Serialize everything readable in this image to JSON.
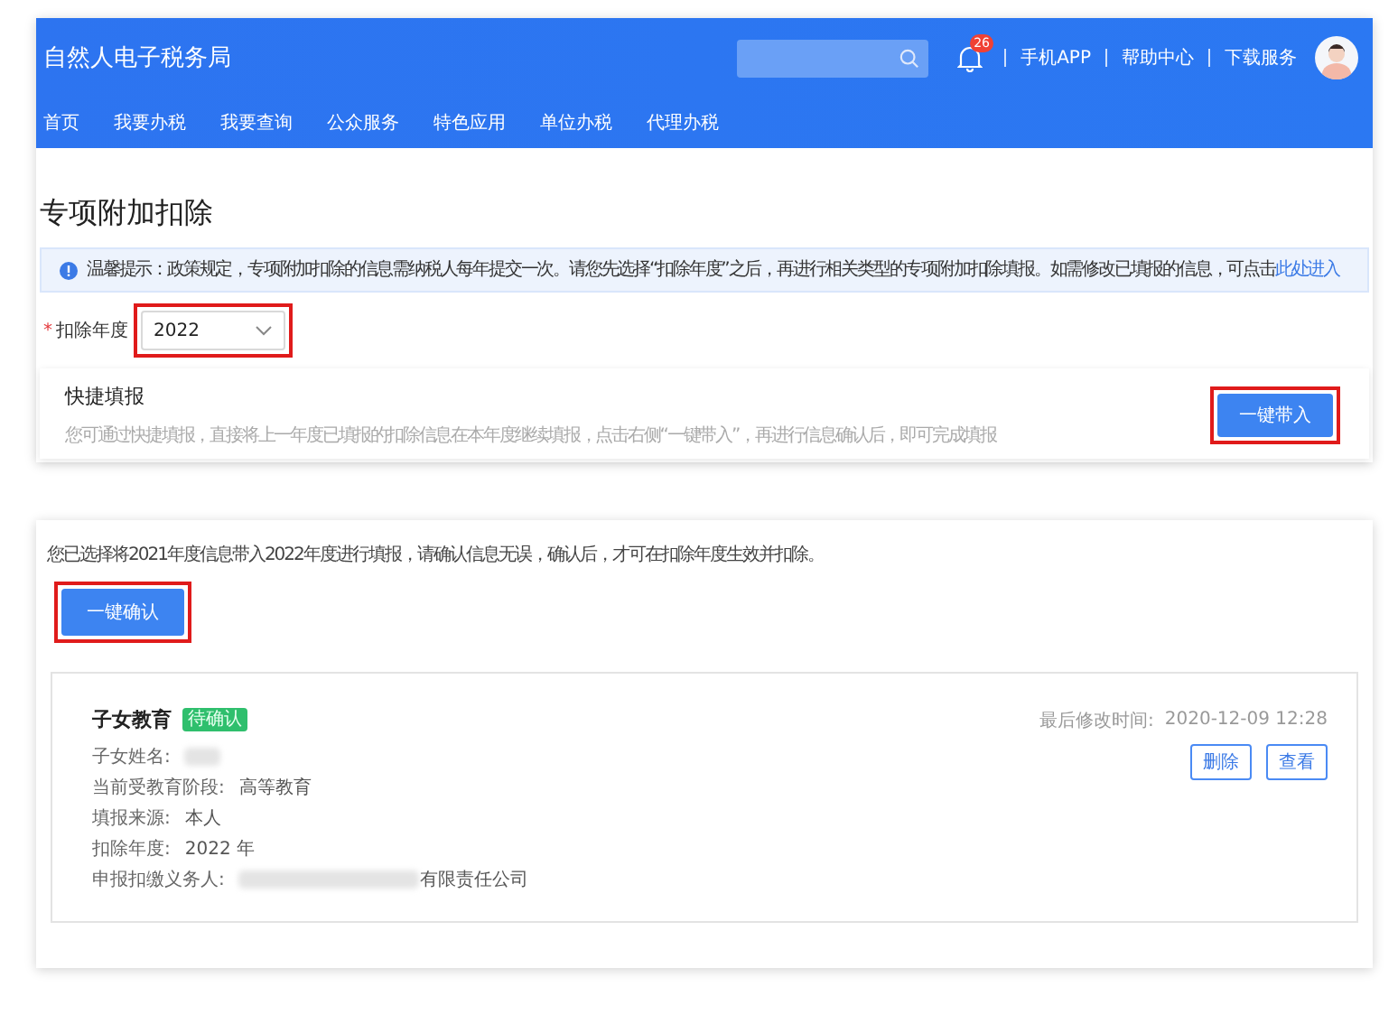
{
  "header": {
    "site_title": "自然人电子税务局",
    "notification_count": "26",
    "links": [
      "手机APP",
      "帮助中心",
      "下载服务"
    ]
  },
  "nav": [
    {
      "label": "首页",
      "selected": false
    },
    {
      "label": "我要办税",
      "selected": false
    },
    {
      "label": "我要查询",
      "selected": false
    },
    {
      "label": "公众服务",
      "selected": false
    },
    {
      "label": "特色应用",
      "selected": false
    },
    {
      "label": "单位办税",
      "selected": false
    },
    {
      "label": "代理办税",
      "selected": false
    }
  ],
  "page_title": "专项附加扣除",
  "notice": {
    "text": "温馨提示：政策规定，专项附加扣除的信息需纳税人每年提交一次。请您先选择“扣除年度”之后，再进行相关类型的专项附加扣除填报。如需修改已填报的信息，可点击",
    "link": "此处进入"
  },
  "year_field": {
    "required_mark": "*",
    "label": "扣除年度",
    "value": "2022"
  },
  "quick_fill": {
    "title": "快捷填报",
    "description": "您可通过快捷填报，直接将上一年度已填报的扣除信息在本年度继续填报，点击右侧“一键带入”，再进行信息确认后，即可完成填报",
    "button": "一键带入"
  },
  "confirm_panel": {
    "message": "您已选择将2021年度信息带入2022年度进行填报，请确认信息无误，确认后，才可在扣除年度生效并扣除。",
    "button": "一键确认"
  },
  "record": {
    "title": "子女教育",
    "status": "待确认",
    "modified_label": "最后修改时间:",
    "modified_time": "2020-12-09 12:28",
    "fields": [
      {
        "label": "子女姓名:",
        "redacted": true
      },
      {
        "label": "当前受教育阶段:",
        "value": "高等教育",
        "redacted": false
      },
      {
        "label": "填报来源:",
        "value": "本人",
        "redacted": false
      },
      {
        "label": "扣除年度:",
        "value": "2022 年",
        "redacted": false
      },
      {
        "label": "申报扣缴义务人:",
        "value": "有限责任公司",
        "redacted": true
      }
    ],
    "actions": [
      "删除",
      "查看"
    ]
  }
}
